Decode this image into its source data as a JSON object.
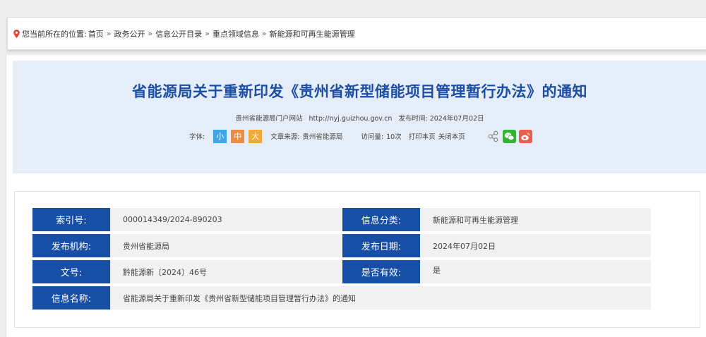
{
  "breadcrumb": {
    "prefix": "您当前所在的位置:",
    "items": [
      "首页",
      "政务公开",
      "信息公开目录",
      "重点领域信息",
      "新能源和可再生能源管理"
    ],
    "separator": "»"
  },
  "article": {
    "title": "省能源局关于重新印发《贵州省新型储能项目管理暂行办法》的通知",
    "site_name": "贵州省能源局门户网站",
    "site_url": "http://nyj.guizhou.gov.cn",
    "publish_label": "发布时间:",
    "publish_date": "2024年07月02日",
    "font_label": "字体:",
    "font_small": "小",
    "font_medium": "中",
    "font_large": "大",
    "source_label": "文章来源:",
    "source": "贵州省能源局",
    "visits_label": "访问量:",
    "visits": "10次",
    "print_label": "打印本页",
    "close_label": "关闭本页"
  },
  "info": {
    "index_label": "索引号:",
    "index_value": "000014349/2024-890203",
    "category_label": "信息分类:",
    "category_value": "新能源和可再生能源管理",
    "org_label": "发布机构:",
    "org_value": "贵州省能源局",
    "date_label": "发布日期:",
    "date_value": "2024年07月02日",
    "doc_label": "文号:",
    "doc_value": "黔能源新〔2024〕46号",
    "valid_label": "是否有效:",
    "valid_value": "是",
    "name_label": "信息名称:",
    "name_value": "省能源局关于重新印发《贵州省新型储能项目管理暂行办法》的通知"
  },
  "colors": {
    "accent": "#174ea6",
    "title": "#1d4ea3",
    "header_bg": "#e5edf8",
    "wechat": "#35b233",
    "weibo": "#e8604c"
  },
  "icons": {
    "location": "location-pin-icon",
    "share": "share-icon",
    "wechat": "wechat-icon",
    "weibo": "weibo-icon"
  }
}
